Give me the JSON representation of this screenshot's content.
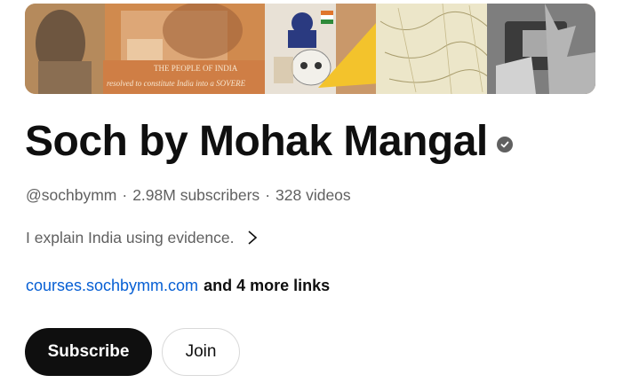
{
  "banner": {
    "text_line1": "THE PEOPLE OF INDIA",
    "text_line2": "resolved to constitute India into a SOVERE"
  },
  "channel": {
    "name": "Soch by Mohak Mangal",
    "verified_icon": "verified-check-icon",
    "handle": "@sochbymm",
    "subscribers": "2.98M subscribers",
    "videos": "328 videos",
    "separator": "·",
    "description": "I explain India using evidence."
  },
  "links": {
    "primary": "courses.sochbymm.com",
    "more": "and 4 more links"
  },
  "actions": {
    "subscribe_label": "Subscribe",
    "join_label": "Join"
  },
  "colors": {
    "link": "#065fd4",
    "subscribe_bg": "#0f0f0f",
    "meta_text": "#606060"
  }
}
